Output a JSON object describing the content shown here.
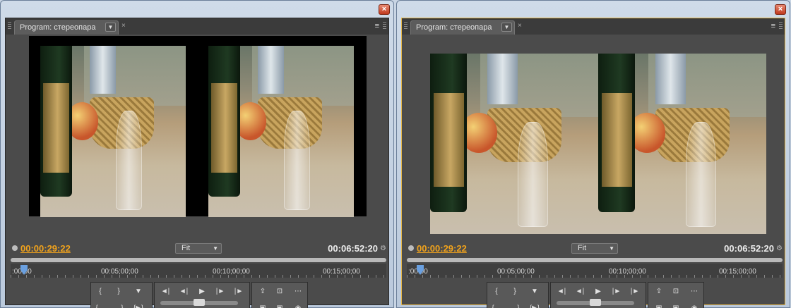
{
  "panels": [
    {
      "tab_title": "Program: стереопара",
      "tab_menu_glyph": "▼",
      "tab_close_glyph": "×",
      "panel_menu_glyph": "≡",
      "current_timecode": "00:00:29:22",
      "zoom_label": "Fit",
      "duration_timecode": "00:06:52:20",
      "ruler_labels": [
        ":00:00",
        "00:05;00;00",
        "00:10;00;00",
        "00:15;00;00"
      ],
      "active": false
    },
    {
      "tab_title": "Program: стереопара",
      "tab_menu_glyph": "▼",
      "tab_close_glyph": "×",
      "panel_menu_glyph": "≡",
      "current_timecode": "00:00:29:22",
      "zoom_label": "Fit",
      "duration_timecode": "00:06:52:20",
      "ruler_labels": [
        ":00:00",
        "00:05;00;00",
        "00:10;00;00",
        "00:15;00;00"
      ],
      "active": true
    }
  ],
  "window_close_glyph": "×",
  "icons": {
    "mark_in": "{",
    "mark_out": "}",
    "set_marker": "▼",
    "step_back": "◄|",
    "play": "▶",
    "step_forward": "|►",
    "go_in": "{←",
    "go_out": "→}",
    "play_in_out": "{▶}",
    "lift": "⇪",
    "extract": "⊡",
    "output": "⋯",
    "trim": "▣",
    "camera": "◉"
  },
  "colors": {
    "timecode_current": "#f0a21c",
    "timecode_duration": "#ececec",
    "panel_bg": "#4b4b4b",
    "active_border": "#e6b84a"
  }
}
